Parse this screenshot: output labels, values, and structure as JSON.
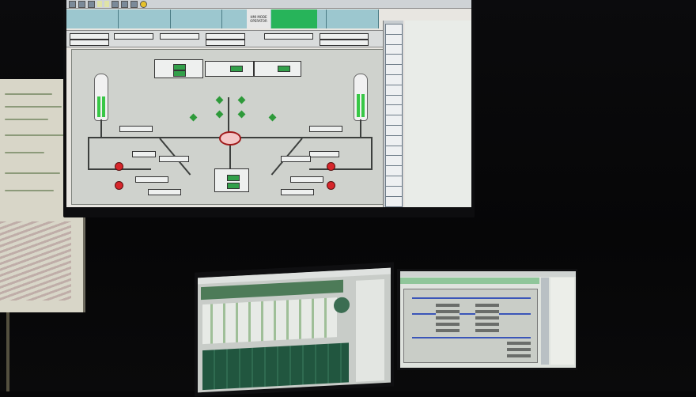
{
  "scene": {
    "description_colors": {
      "wall": "#070708",
      "accent_green": "#27b45a",
      "alarm_red": "#d6262b",
      "status_cyan": "#9cc7cf"
    }
  },
  "main_screen": {
    "toolbar": {
      "tab_1": "",
      "tab_2": ""
    },
    "status_cells": [
      "",
      "",
      "",
      "",
      "",
      ""
    ],
    "mode_label": "HMI MODE\nOPERATOR",
    "alarm_label": "",
    "right_buttons": [
      "",
      "",
      "",
      "",
      "",
      "",
      "",
      "",
      "",
      "",
      "",
      "",
      "",
      "",
      "",
      "",
      "",
      ""
    ],
    "mimic": {
      "title": "",
      "vessel_left_level": 0.55,
      "vessel_right_level": 0.6
    }
  },
  "icons": {
    "windows": "windows-icon",
    "pump": "pump-icon",
    "valve": "valve-icon"
  }
}
